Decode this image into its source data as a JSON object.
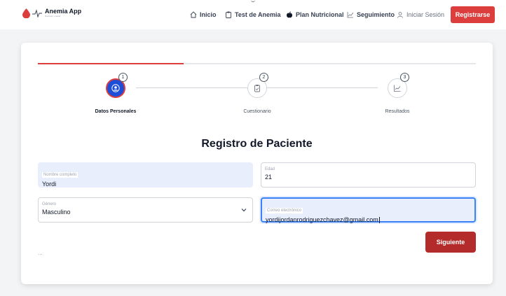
{
  "brand": {
    "name": "Anemia App",
    "tagline": "Nutrición y salud"
  },
  "nav": {
    "inicio": "Inicio",
    "test": "Test de Anemia",
    "plan": "Plan Nutricional",
    "seguimiento": "Seguimiento",
    "login": "Iniciar Sesión",
    "register": "Registrarse"
  },
  "stepper": {
    "progress_fraction": 0.333,
    "steps": [
      {
        "number": "1",
        "label": "Datos Personales",
        "icon": "user-icon",
        "state": "active"
      },
      {
        "number": "2",
        "label": "Cuestionario",
        "icon": "clipboard-icon",
        "state": "pending"
      },
      {
        "number": "3",
        "label": "Resultados",
        "icon": "trend-icon",
        "state": "pending"
      }
    ]
  },
  "form": {
    "title": "Registro de Paciente",
    "nombre": {
      "label": "Nombre completo",
      "value": "Yordi"
    },
    "edad": {
      "label": "Edad",
      "value": "21"
    },
    "genero": {
      "label": "Género",
      "value": "Masculino"
    },
    "correo": {
      "label": "Correo electrónico",
      "value": "yordijordanrodriguezchavez@gmail.com"
    },
    "next_label": "Siguiente",
    "ellipsis": "..."
  },
  "colors": {
    "accent": "#dc3e3e",
    "active_step": "#1d4ed8",
    "focus": "#3b82f6"
  }
}
